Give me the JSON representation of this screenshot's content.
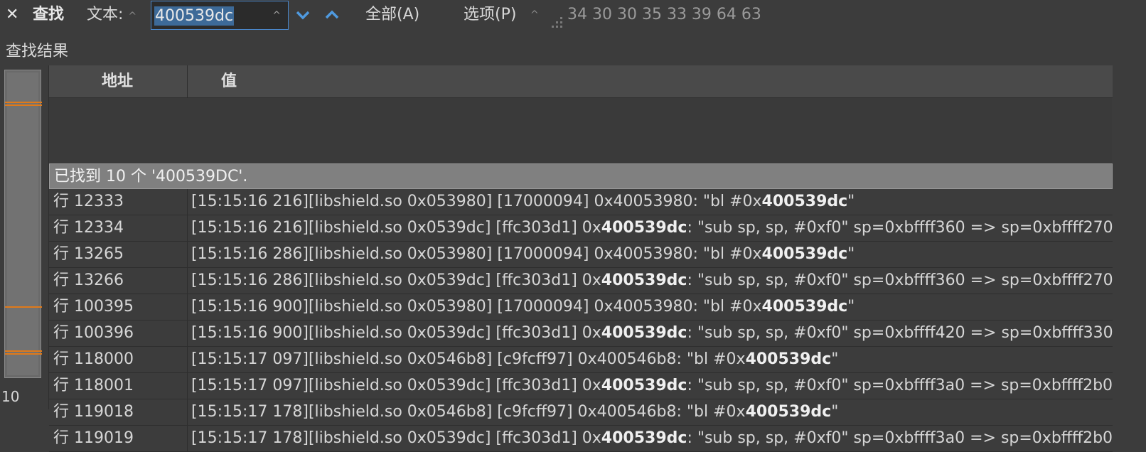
{
  "toolbar": {
    "close_glyph": "✕",
    "title": "查找",
    "text_label": "文本:",
    "search_value": "400539dc",
    "all_label": "全部(A)",
    "options_label": "选项(P)",
    "hex_bytes": "34 30 30 35 33 39 64 63"
  },
  "results": {
    "title": "查找结果",
    "side_count": "10",
    "columns": {
      "address": "地址",
      "value": "值"
    },
    "summary": "已找到 10 个 '400539DC'.",
    "highlight": "400539dc",
    "rows": [
      {
        "addr": "行 12333",
        "pre": "[15:15:16 216][libshield.so 0x053980] [17000094] 0x40053980: \"bl #0x",
        "post": "\""
      },
      {
        "addr": "行 12334",
        "pre": "[15:15:16 216][libshield.so 0x0539dc] [ffc303d1] 0x",
        "post": ": \"sub sp, sp, #0xf0\" sp=0xbffff360 => sp=0xbffff270"
      },
      {
        "addr": "行 13265",
        "pre": "[15:15:16 286][libshield.so 0x053980] [17000094] 0x40053980: \"bl #0x",
        "post": "\""
      },
      {
        "addr": "行 13266",
        "pre": "[15:15:16 286][libshield.so 0x0539dc] [ffc303d1] 0x",
        "post": ": \"sub sp, sp, #0xf0\" sp=0xbffff360 => sp=0xbffff270"
      },
      {
        "addr": "行 100395",
        "pre": "[15:15:16 900][libshield.so 0x053980] [17000094] 0x40053980: \"bl #0x",
        "post": "\""
      },
      {
        "addr": "行 100396",
        "pre": "[15:15:16 900][libshield.so 0x0539dc] [ffc303d1] 0x",
        "post": ": \"sub sp, sp, #0xf0\" sp=0xbffff420 => sp=0xbffff330"
      },
      {
        "addr": "行 118000",
        "pre": "[15:15:17 097][libshield.so 0x0546b8] [c9fcff97] 0x400546b8: \"bl #0x",
        "post": "\""
      },
      {
        "addr": "行 118001",
        "pre": "[15:15:17 097][libshield.so 0x0539dc] [ffc303d1] 0x",
        "post": ": \"sub sp, sp, #0xf0\" sp=0xbffff3a0 => sp=0xbffff2b0"
      },
      {
        "addr": "行 119018",
        "pre": "[15:15:17 178][libshield.so 0x0546b8] [c9fcff97] 0x400546b8: \"bl #0x",
        "post": "\""
      },
      {
        "addr": "行 119019",
        "pre": "[15:15:17 178][libshield.so 0x0539dc] [ffc303d1] 0x",
        "post": ": \"sub sp, sp, #0xf0\" sp=0xbffff3a0 => sp=0xbffff2b0"
      }
    ]
  },
  "colors": {
    "accent_nav": "#4f9ae0",
    "match_marker": "#e07a1a",
    "search_border": "#4a86c8"
  }
}
